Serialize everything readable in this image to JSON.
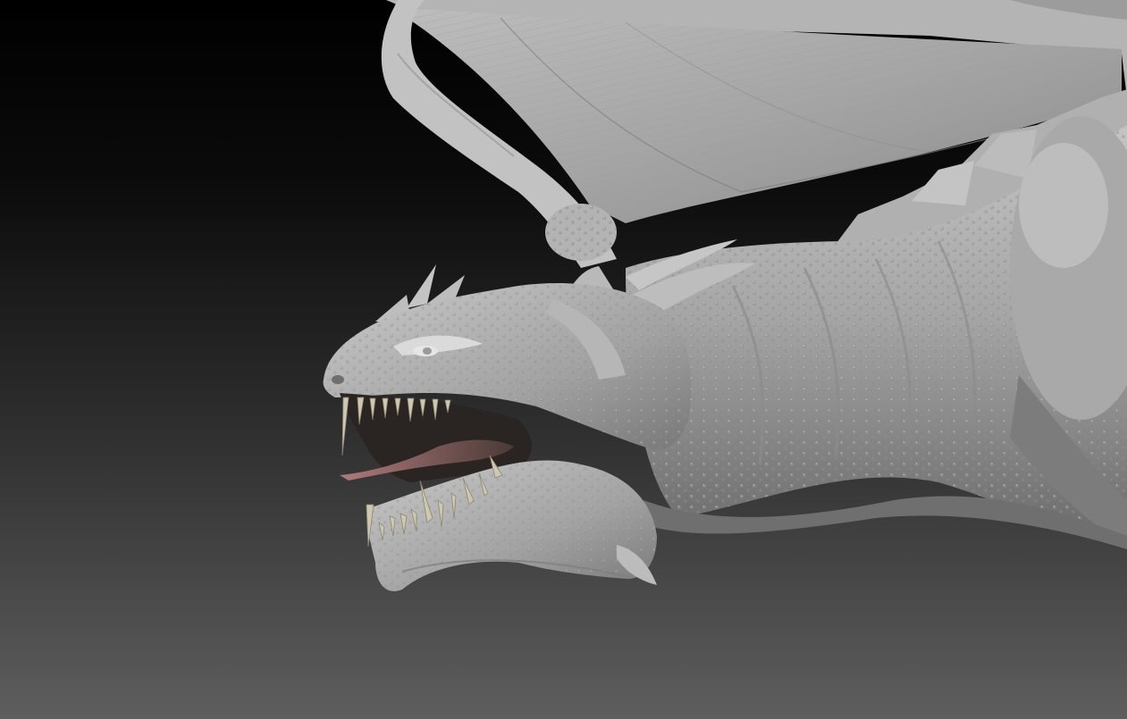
{
  "viewport": {
    "background_top": "#000000",
    "background_bottom": "#5e5e5e"
  },
  "model": {
    "subject": "dragon-sculpt",
    "material_color": "#a8a8a8",
    "highlight_color": "#d2d2d2",
    "shadow_color": "#5a5a5a",
    "teeth_color": "#cfc8b0",
    "tongue_color": "#5e4a44"
  }
}
